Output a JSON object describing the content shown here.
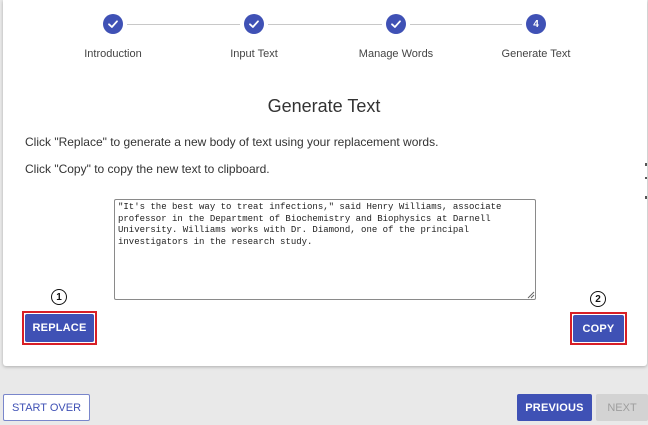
{
  "stepper": {
    "steps": [
      {
        "label": "Introduction",
        "state": "completed",
        "icon": "check-icon"
      },
      {
        "label": "Input Text",
        "state": "completed",
        "icon": "check-icon"
      },
      {
        "label": "Manage Words",
        "state": "completed",
        "icon": "check-icon"
      },
      {
        "label": "Generate Text",
        "state": "active",
        "number": "4"
      }
    ]
  },
  "main": {
    "title": "Generate Text",
    "instruction_replace": "Click \"Replace\" to generate a new body of text using your replacement words.",
    "instruction_copy": "Click \"Copy\" to copy the new text to clipboard.",
    "output_text": "\"It's the best way to treat infections,\" said Henry Williams, associate professor in the Department of Biochemistry and Biophysics at Darnell University. Williams works with Dr. Diamond, one of the principal investigators in the research study."
  },
  "actions": {
    "replace_marker": "1",
    "replace_label": "REPLACE",
    "copy_marker": "2",
    "copy_label": "COPY"
  },
  "footer": {
    "start_over_label": "START OVER",
    "previous_label": "PREVIOUS",
    "next_label": "NEXT"
  },
  "colors": {
    "primary": "#3f51b5",
    "highlight": "#d81f26",
    "disabled": "#d3d3d3"
  }
}
